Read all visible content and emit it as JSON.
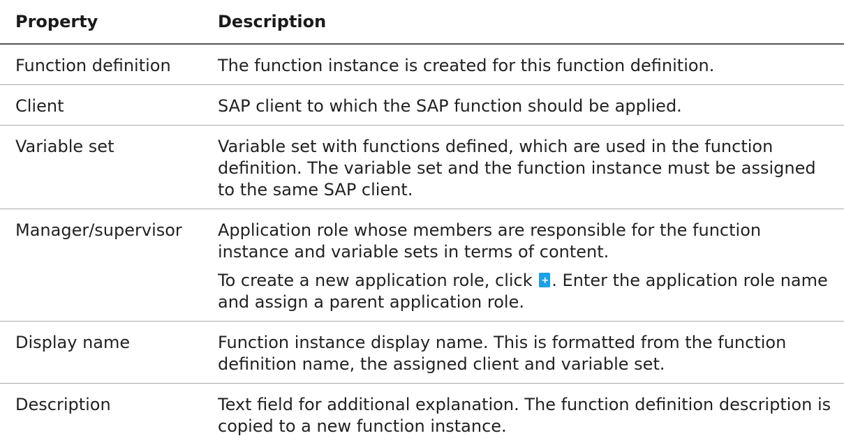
{
  "table": {
    "headers": {
      "property": "Property",
      "description": "Description"
    },
    "rows": [
      {
        "property": "Function definition",
        "description": "The function instance is created for this function definition."
      },
      {
        "property": "Client",
        "description": "SAP client to which the SAP function should be applied."
      },
      {
        "property": "Variable set",
        "description": "Variable set with functions defined, which are used in the function definition. The variable set and the function instance must be assigned to the same SAP client."
      },
      {
        "property": "Manager/supervisor",
        "description": "Application role whose members are responsible for the function instance and variable sets in terms of content.",
        "note_before_icon": "To create a new application role, click",
        "note_after_icon": ". Enter the application role name and assign a parent application role.",
        "icon": "add-application-role-icon"
      },
      {
        "property": "Display name",
        "description": "Function instance display name. This is formatted from the function definition name, the assigned client and variable set."
      },
      {
        "property": "Description",
        "description": "Text field for additional explanation. The function definition description is copied to a new function instance."
      }
    ]
  },
  "colors": {
    "text": "#222222",
    "icon_accent": "#1aa0e6",
    "header_rule": "#555555",
    "row_rule": "#aaaaaa"
  }
}
